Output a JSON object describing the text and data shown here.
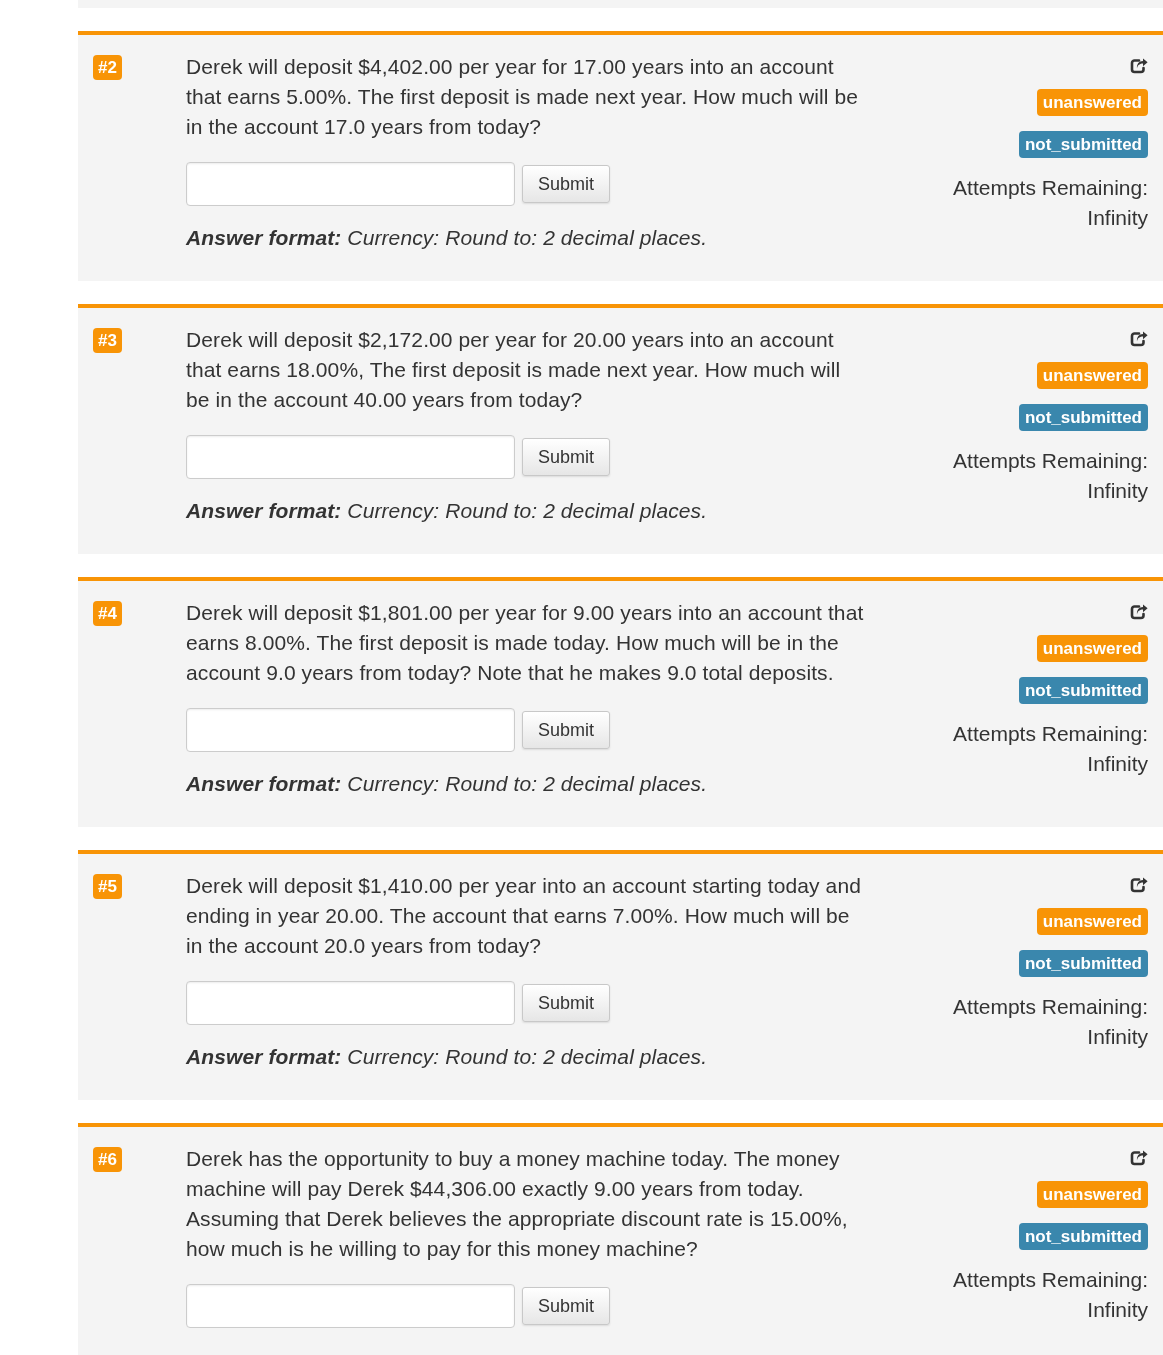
{
  "questions": [
    {
      "number": "#2",
      "text": "Derek will deposit $4,402.00 per year for 17.00 years into an account that earns 5.00%. The first deposit is made next year. How much will be in the account 17.0 years from today?",
      "submit_button": "Submit",
      "answer_format": "**Answer format:** Currency: Round to: 2 decimal places.",
      "badges": [
        {
          "label": "unanswered",
          "color": "#f89406"
        },
        {
          "label": "not_submitted",
          "color": "#3a87ad"
        }
      ],
      "attempts_label": "Attempts Remaining:",
      "attempts_value": "Infinity"
    },
    {
      "number": "#3",
      "text": "Derek will deposit $2,172.00 per year for 20.00 years into an account that earns 18.00%, The first deposit is made next year. How much will be in the account 40.00 years from today?",
      "submit_button": "Submit",
      "answer_format": "**Answer format:** Currency: Round to: 2 decimal places.",
      "badges": [
        {
          "label": "unanswered",
          "color": "#f89406"
        },
        {
          "label": "not_submitted",
          "color": "#3a87ad"
        }
      ],
      "attempts_label": "Attempts Remaining:",
      "attempts_value": "Infinity"
    },
    {
      "number": "#4",
      "text": "Derek will deposit $1,801.00 per year for 9.00 years into an account that earns 8.00%. The first deposit is made today. How much will be in the account 9.0 years from today? Note that he makes 9.0 total deposits.",
      "submit_button": "Submit",
      "answer_format": "**Answer format:** Currency: Round to: 2 decimal places.",
      "badges": [
        {
          "label": "unanswered",
          "color": "#f89406"
        },
        {
          "label": "not_submitted",
          "color": "#3a87ad"
        }
      ],
      "attempts_label": "Attempts Remaining:",
      "attempts_value": "Infinity"
    },
    {
      "number": "#5",
      "text": "Derek will deposit $1,410.00 per year into an account starting today and ending in year 20.00. The account that earns 7.00%. How much will be in the account 20.0 years from today?",
      "submit_button": "Submit",
      "answer_format": "**Answer format:** Currency: Round to: 2 decimal places.",
      "badges": [
        {
          "label": "unanswered",
          "color": "#f89406"
        },
        {
          "label": "not_submitted",
          "color": "#3a87ad"
        }
      ],
      "attempts_label": "Attempts Remaining:",
      "attempts_value": "Infinity"
    },
    {
      "number": "#6",
      "text": "Derek has the opportunity to buy a money machine today. The money machine will pay Derek $44,306.00 exactly 9.00 years from today. Assuming that Derek believes the appropriate discount rate is 15.00%, how much is he willing to pay for this money machine?",
      "submit_button": "Submit",
      "badges": [
        {
          "label": "unanswered",
          "color": "#f89406"
        },
        {
          "label": "not_submitted",
          "color": "#3a87ad"
        }
      ],
      "attempts_label": "Attempts Remaining:",
      "attempts_value": "Infinity"
    }
  ]
}
